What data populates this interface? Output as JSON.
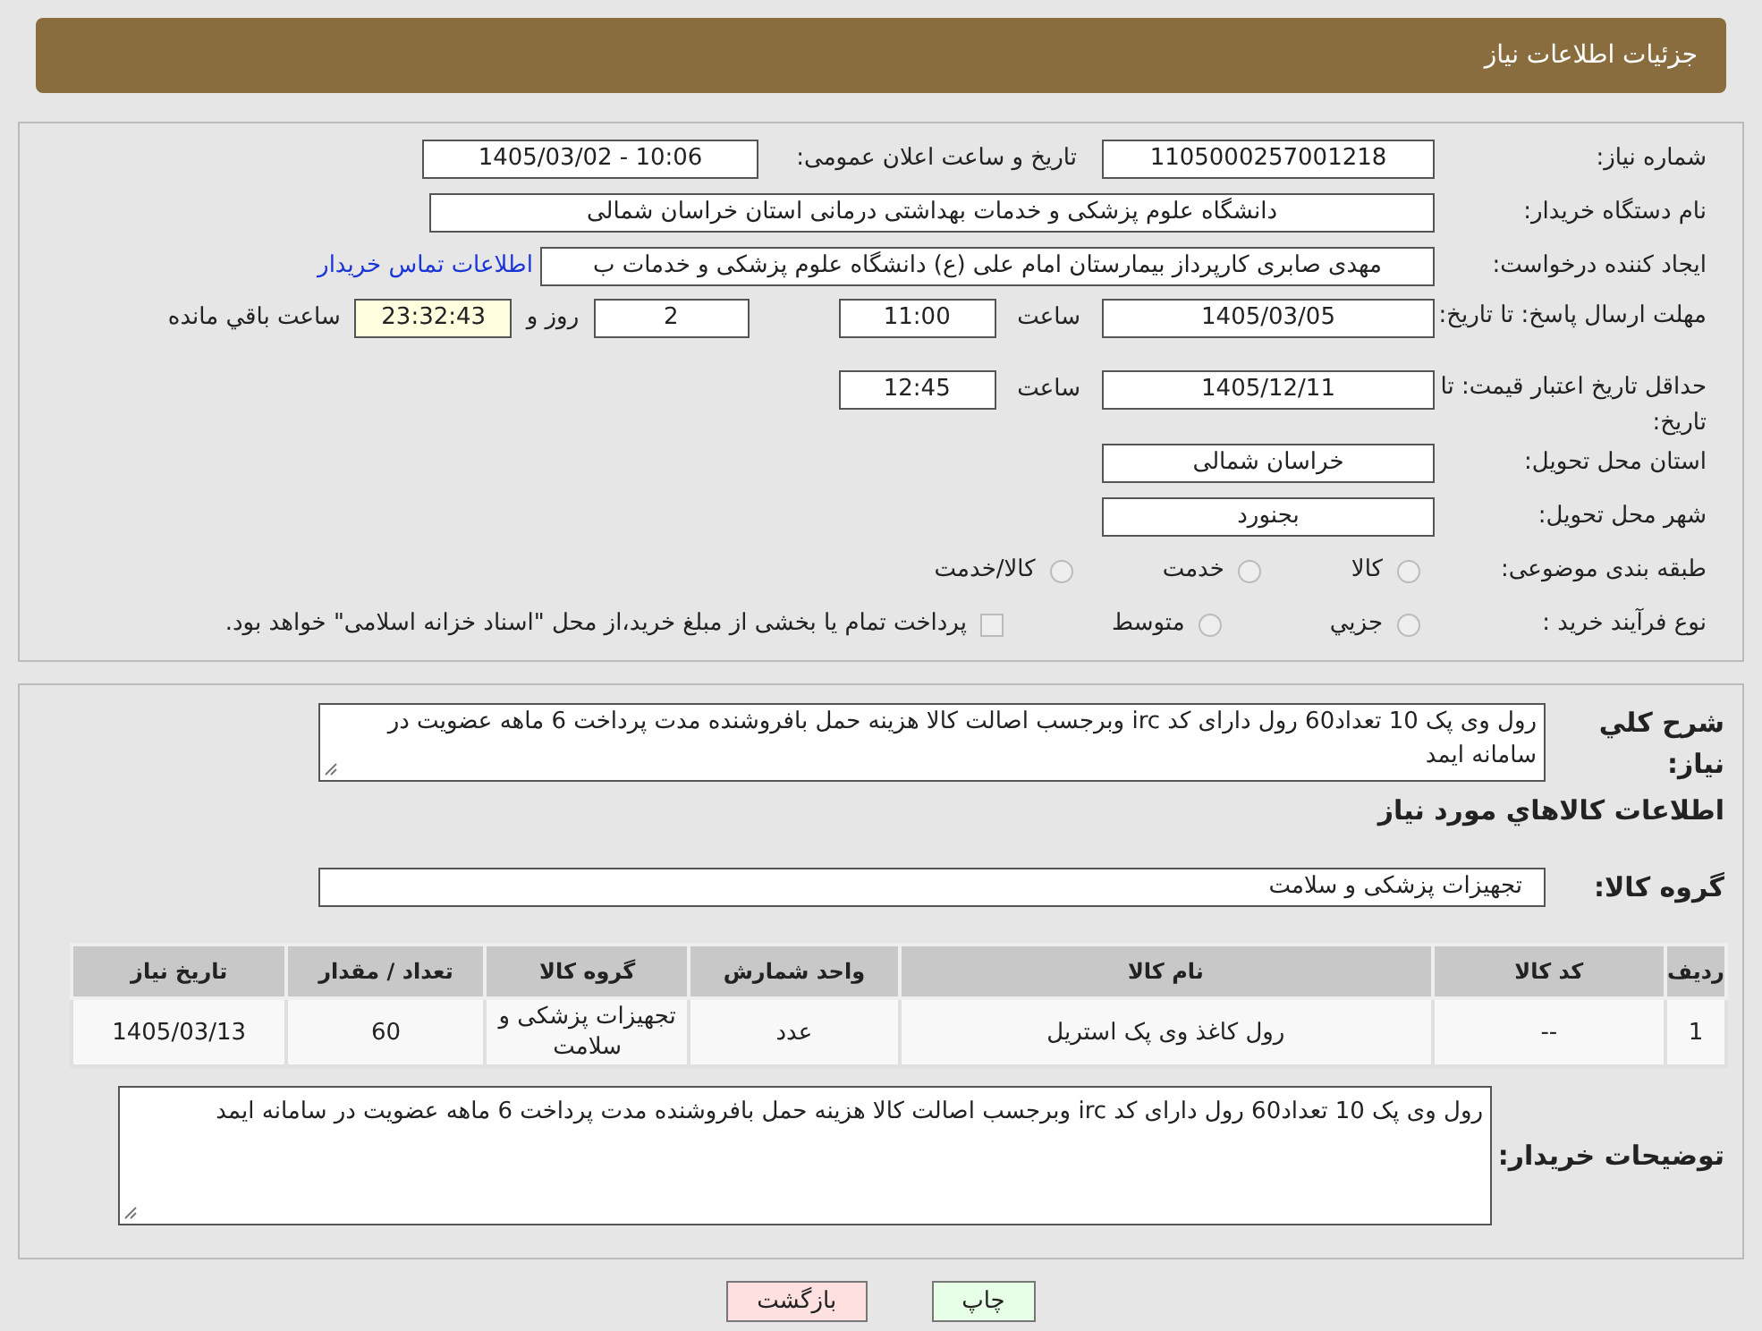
{
  "header": {
    "title": "جزئیات اطلاعات نیاز"
  },
  "info": {
    "need_number": {
      "label": "شماره نیاز:",
      "value": "1105000257001218"
    },
    "announce": {
      "label": "تاریخ و ساعت اعلان عمومی:",
      "value": "1405/03/02 - 10:06"
    },
    "buyer_org": {
      "label": "نام دستگاه خریدار:",
      "value": "دانشگاه علوم پزشکی و خدمات بهداشتی درمانی استان خراسان شمالی"
    },
    "requester": {
      "label": "ایجاد کننده درخواست:",
      "value": "مهدی صابری کارپرداز بیمارستان امام علی (ع) دانشگاه علوم پزشکی و خدمات ب",
      "link": "اطلاعات تماس خریدار"
    },
    "deadline": {
      "label": "مهلت ارسال پاسخ: تا تاریخ:",
      "date": "1405/03/05",
      "time_label": "ساعت",
      "time": "11:00",
      "days": "2",
      "days_label": "روز و",
      "remaining": "23:32:43",
      "remaining_label": "ساعت باقي مانده"
    },
    "validity": {
      "label": "حداقل تاریخ اعتبار قیمت: تا تاریخ:",
      "date": "1405/12/11",
      "time_label": "ساعت",
      "time": "12:45"
    },
    "province": {
      "label": "استان محل تحویل:",
      "value": "خراسان شمالی"
    },
    "city": {
      "label": "شهر محل تحویل:",
      "value": "بجنورد"
    },
    "category": {
      "label": "طبقه بندی موضوعی:",
      "options": [
        {
          "label": "کالا",
          "selected": false
        },
        {
          "label": "خدمت",
          "selected": false
        },
        {
          "label": "کالا/خدمت",
          "selected": false
        }
      ]
    },
    "process": {
      "label": "نوع فرآیند خرید :",
      "options": [
        {
          "label": "جزیي",
          "selected": false
        },
        {
          "label": "متوسط",
          "selected": false
        }
      ],
      "treasury": {
        "label": "پرداخت تمام یا بخشی از مبلغ خرید،از محل \"اسناد خزانه اسلامی\" خواهد بود.",
        "checked": false
      }
    }
  },
  "summary": {
    "label": "شرح کلي نیاز:",
    "value": "رول وی پک 10 تعداد60 رول دارای کد irc وبرجسب اصالت کالا هزینه حمل بافروشنده مدت پرداخت 6 ماهه عضویت در سامانه ایمد"
  },
  "goods_title": "اطلاعات کالاهاي مورد نیاز",
  "goods_group": {
    "label": "گروه کالا:",
    "value": "تجهیزات پزشکی و سلامت"
  },
  "table": {
    "columns": [
      "ردیف",
      "کد کالا",
      "نام کالا",
      "واحد شمارش",
      "گروه کالا",
      "تعداد / مقدار",
      "تاریخ نیاز"
    ],
    "rows": [
      [
        "1",
        "--",
        "رول کاغذ وی پک استریل",
        "عدد",
        "تجهیزات پزشکی و سلامت",
        "60",
        "1405/03/13"
      ]
    ]
  },
  "buyer_notes": {
    "label": "توضیحات خریدار:",
    "value": "رول وی پک 10 تعداد60 رول دارای کد irc وبرجسب اصالت کالا هزینه حمل بافروشنده مدت پرداخت 6 ماهه عضویت در سامانه ایمد"
  },
  "buttons": [
    {
      "label": "چاپ",
      "kind": "print"
    },
    {
      "label": "بازگشت",
      "kind": "back"
    }
  ]
}
